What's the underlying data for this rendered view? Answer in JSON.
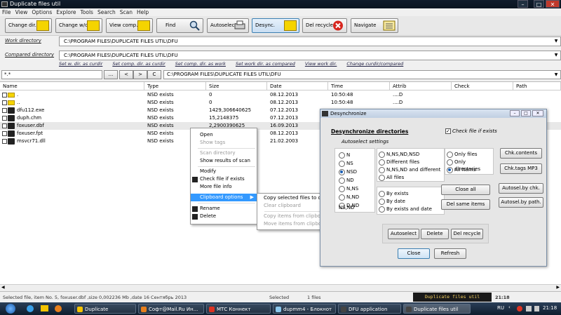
{
  "window": {
    "title": "Duplicate files util"
  },
  "menu": [
    "File",
    "View",
    "Options",
    "Explore",
    "Tools",
    "Search",
    "Scan",
    "Help"
  ],
  "toolbar": [
    {
      "label": "Change dir.",
      "icon": "folder-icon"
    },
    {
      "label": "Change w/c",
      "icon": "folder-icon"
    },
    {
      "label": "View comp.",
      "icon": "folder-icon"
    },
    {
      "label": "Find",
      "icon": "magnifier-icon"
    },
    {
      "label": "Autoselect",
      "icon": "printer-icon"
    },
    {
      "label": "Desync.",
      "icon": "folder-doc-icon"
    },
    {
      "label": "Del recycle",
      "icon": "delete-icon"
    },
    {
      "label": "Navigate",
      "icon": "list-icon"
    }
  ],
  "work_dir": {
    "label": "Work directory",
    "value": "C:\\PROGRAM FILES\\DUPLICATE FILES UTIL\\DFU"
  },
  "compared_dir": {
    "label": "Compared directory",
    "value": "C:\\PROGRAM FILES\\DUPLICATE FILES UTIL\\DFU"
  },
  "links": [
    "Set w. dir. as curdir",
    "Set comp. dir. as curdir",
    "Set comp. dir. as work",
    "Set work dir. as compared",
    "View work dir.",
    "Change curdir/compared"
  ],
  "nav": {
    "filter": "*.*",
    "dots": "...",
    "back": "<",
    "forward": ">",
    "c": "C",
    "path": "C:\\PROGRAM FILES\\DUPLICATE FILES UTIL\\DFU"
  },
  "columns": [
    "Name",
    "Type",
    "Size",
    "Date",
    "Time",
    "Attrib",
    "Check",
    "Path"
  ],
  "rows": [
    {
      "name": ".",
      "type": "NSD exists",
      "size": "0",
      "date": "08.12.2013",
      "time": "10:50:48",
      "attrib": "....D",
      "kind": "folder"
    },
    {
      "name": "..",
      "type": "NSD exists",
      "size": "0",
      "date": "08.12.2013",
      "time": "10:50:48",
      "attrib": "....D",
      "kind": "folder"
    },
    {
      "name": "dfu112.exe",
      "type": "NSD exists",
      "size": "1429,306640625",
      "date": "07.12.2013",
      "time": "",
      "attrib": "",
      "kind": "file"
    },
    {
      "name": "duph.chm",
      "type": "NSD exists",
      "size": "15,2148375",
      "date": "07.12.2013",
      "time": "",
      "attrib": "",
      "kind": "file"
    },
    {
      "name": "foxuser.dbf",
      "type": "NSD exists",
      "size": "2,2900390625",
      "date": "16.09.2013",
      "time": "",
      "attrib": "",
      "kind": "file"
    },
    {
      "name": "foxuser.fpt",
      "type": "NSD exists",
      "size": "",
      "date": "08.12.2013",
      "time": "",
      "attrib": "",
      "kind": "file"
    },
    {
      "name": "msvcr71.dll",
      "type": "NSD exists",
      "size": "",
      "date": "21.02.2003",
      "time": "",
      "attrib": "",
      "kind": "file"
    }
  ],
  "context_menu": [
    {
      "label": "Open",
      "disabled": false
    },
    {
      "label": "Show tags",
      "disabled": true
    },
    {
      "label": "Scan directory",
      "disabled": true
    },
    {
      "label": "Show results of scan",
      "disabled": false
    },
    {
      "label": "Modify",
      "disabled": false
    },
    {
      "label": "Check file if exists",
      "disabled": false
    },
    {
      "label": "More file info",
      "disabled": false
    },
    {
      "label": "Clipboard options",
      "disabled": false
    },
    {
      "label": "Rename",
      "disabled": false
    },
    {
      "label": "Delete",
      "disabled": false
    }
  ],
  "submenu": [
    {
      "label": "Copy selected files to clipboard",
      "disabled": false
    },
    {
      "label": "Clear clipboard",
      "disabled": true
    },
    {
      "label": "Copy items from clipboard",
      "disabled": true
    },
    {
      "label": "Move items from clipboard",
      "disabled": true
    }
  ],
  "dialog": {
    "title": "Desynchronize",
    "heading": "Desynchronize directories",
    "check_label": "Check file if exists",
    "autoselect_label": "Autoselect settings",
    "group1": [
      "N",
      "NS",
      "NSD",
      "ND",
      "N,NS",
      "N,ND",
      "D,ND",
      "NS,ND"
    ],
    "group1_selected": "NSD",
    "group2": [
      "N,NS,ND,NSD",
      "Different files",
      "N,NS,ND and different",
      "All files"
    ],
    "group3": [
      "Only files",
      "Only directories",
      "All items"
    ],
    "group3_selected": "All items",
    "group4": [
      "By exists",
      "By date",
      "By exists and date"
    ],
    "buttons": {
      "chk_contents": "Chk.contents",
      "chk_tags": "Chk.tags MP3",
      "close_all": "Close all",
      "del_same": "Del same items",
      "autosel_chk": "Autosel.by chk.",
      "autosel_path": "Autosel.by path.",
      "autoselect": "Autoselect",
      "delete": "Delete",
      "del_recycle": "Del recycle",
      "close": "Close",
      "refresh": "Refresh"
    }
  },
  "status": {
    "left": "Selected file, item No. 5, foxuser.dbf ,size 0,002236 Mb  ,date 16 Сентябрь 2013",
    "selected_label": "Selected",
    "selected_count": "1 files",
    "brand": "Duplicate files util",
    "clock": "21:18"
  },
  "taskbar": {
    "items": [
      "Duplicate",
      "Софт@Mail.Ru Ин...",
      "МТС Коннект",
      "dupmm4 - Блокнот",
      "DFU application",
      "Duplicate files util"
    ],
    "lang": "RU",
    "time": "21:18"
  }
}
